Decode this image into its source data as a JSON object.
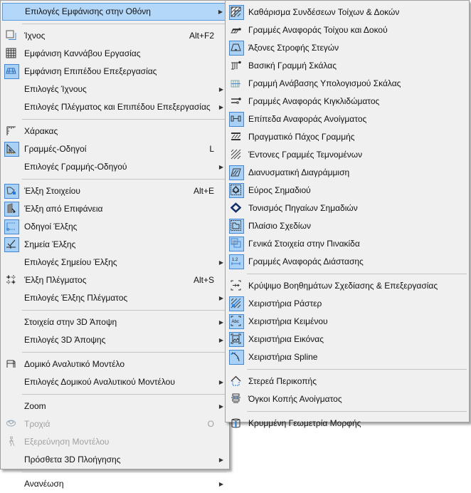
{
  "main_menu": [
    {
      "label": "Επιλογές Εμφάνισης στην Οθόνη",
      "submenu": true,
      "highlighted": true
    },
    {
      "sep": true
    },
    {
      "label": "Ίχνος",
      "icon": "trace-icon",
      "shortcut": "Alt+F2"
    },
    {
      "label": "Εμφάνιση Καννάβου Εργασίας",
      "icon": "grid-icon"
    },
    {
      "label": "Εμφάνιση Επιπέδου Επεξεργασίας",
      "icon": "editing-plane-icon",
      "checked": true
    },
    {
      "label": "Επιλογές Ίχνους",
      "submenu": true
    },
    {
      "label": "Επιλογές Πλέγματος και Επιπέδου Επεξεργασίας",
      "submenu": true
    },
    {
      "sep": true
    },
    {
      "label": "Χάρακας",
      "icon": "ruler-icon"
    },
    {
      "label": "Γραμμές-Οδηγοί",
      "icon": "guide-lines-icon",
      "checked": true,
      "shortcut": "L"
    },
    {
      "label": "Επιλογές Γραμμής-Οδηγού",
      "submenu": true
    },
    {
      "sep": true
    },
    {
      "label": "Έλξη Στοιχείου",
      "icon": "element-snap-icon",
      "checked": true,
      "shortcut": "Alt+E"
    },
    {
      "label": "Έλξη από Επιφάνεια",
      "icon": "surface-snap-icon",
      "checked": true
    },
    {
      "label": "Οδηγοί Έλξης",
      "icon": "snap-guides-icon",
      "checked": true
    },
    {
      "label": "Σημεία Έλξης",
      "icon": "snap-points-icon",
      "checked": true
    },
    {
      "label": "Επιλογές Σημείου Έλξης",
      "submenu": true
    },
    {
      "label": "Έλξη Πλέγματος",
      "icon": "grid-snap-icon",
      "shortcut": "Alt+S"
    },
    {
      "label": "Επιλογές Έλξης Πλέγματος",
      "submenu": true
    },
    {
      "sep": true
    },
    {
      "label": "Στοιχεία στην 3D Άποψη",
      "submenu": true
    },
    {
      "label": "Επιλογές 3D Άποψης",
      "submenu": true
    },
    {
      "sep": true
    },
    {
      "label": "Δομικό Αναλυτικό Μοντέλο",
      "icon": "analytical-model-icon"
    },
    {
      "label": "Επιλογές Δομικού Αναλυτικού Μοντέλου",
      "submenu": true
    },
    {
      "sep": true
    },
    {
      "label": "Zoom",
      "submenu": true
    },
    {
      "label": "Τροχιά",
      "icon": "orbit-icon",
      "shortcut": "O",
      "disabled": true
    },
    {
      "label": "Εξερεύνηση Μοντέλου",
      "icon": "explore-icon",
      "disabled": true
    },
    {
      "label": "Πρόσθετα 3D Πλοήγησης",
      "submenu": true
    },
    {
      "sep": true
    },
    {
      "label": "Ανανέωση",
      "submenu": true
    }
  ],
  "sub_menu": [
    {
      "label": "Καθάρισμα Συνδέσεων Τοίχων & Δοκών",
      "icon": "clean-intersections-icon",
      "checked": true
    },
    {
      "label": "Γραμμές Αναφοράς Τοίχου και Δοκού",
      "icon": "wall-reference-line-icon"
    },
    {
      "label": "Άξονες Στροφής Στεγών",
      "icon": "roof-pivot-icon",
      "checked": true
    },
    {
      "label": "Βασική Γραμμή Σκάλας",
      "icon": "stair-baseline-icon"
    },
    {
      "label": "Γραμμή Ανάβασης Υπολογισμού Σκάλας",
      "icon": "stair-walking-line-icon"
    },
    {
      "label": "Γραμμές Αναφοράς Κιγκλιδώματος",
      "icon": "railing-reference-icon"
    },
    {
      "label": "Επίπεδα Αναφοράς Ανοίγματος",
      "icon": "opening-reference-icon",
      "checked": true
    },
    {
      "label": "Πραγματικό Πάχος Γραμμής",
      "icon": "true-line-weight-icon"
    },
    {
      "label": "Έντονες Γραμμές Τεμνομένων",
      "icon": "bold-cut-lines-icon"
    },
    {
      "label": "Διανυσματική Διαγράμμιση",
      "icon": "vectorial-hatching-icon",
      "checked": true
    },
    {
      "label": "Εύρος Σημαδιού",
      "icon": "marker-range-icon",
      "checked": true
    },
    {
      "label": "Τονισμός Πηγαίων Σημαδιών",
      "icon": "source-marker-icon"
    },
    {
      "label": "Πλαίσιο Σχεδίων",
      "icon": "drawing-frame-icon",
      "checked": true
    },
    {
      "label": "Γενικά Στοιχεία στην Πινακίδα",
      "icon": "master-items-icon",
      "checked": true
    },
    {
      "label": "Γραμμές Αναφοράς Διάστασης",
      "icon": "dimension-reference-icon",
      "checked": true
    },
    {
      "sep": true
    },
    {
      "label": "Κρύψιμο Βοηθημάτων Σχεδίασης & Επεξεργασίας",
      "icon": "hide-aids-icon"
    },
    {
      "label": "Χειριστήρια Ράστερ",
      "icon": "raster-handles-icon",
      "checked": true
    },
    {
      "label": "Χειριστήρια Κειμένου",
      "icon": "text-handles-icon",
      "checked": true
    },
    {
      "label": "Χειριστήρια Εικόνας",
      "icon": "image-handles-icon",
      "checked": true
    },
    {
      "label": "Χειριστήρια Spline",
      "icon": "spline-handles-icon",
      "checked": true
    },
    {
      "sep": true
    },
    {
      "label": "Στερεά Περικοπής",
      "icon": "trimming-bodies-icon"
    },
    {
      "label": "Όγκοι Κοπής Ανοίγματος",
      "icon": "opening-cut-bodies-icon"
    },
    {
      "sep": true
    },
    {
      "label": "Κρυμμένη Γεωμετρία Μορφής",
      "icon": "hidden-geometry-icon"
    }
  ],
  "arrow_glyph": "▶",
  "colors": {
    "highlight": "#b3d7f8",
    "checked_bg": "#a9d0f5",
    "checked_border": "#3f86d6",
    "menu_bg": "#f0f0f0"
  }
}
